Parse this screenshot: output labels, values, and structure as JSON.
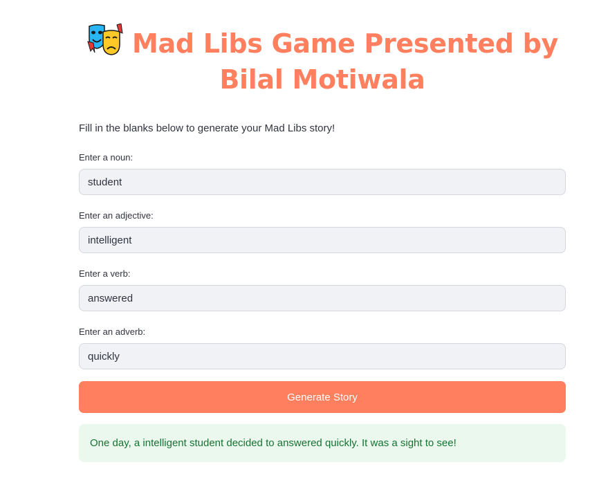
{
  "header": {
    "icon": "performing-arts-masks-icon",
    "title_line1": "Mad Libs Game Presented by",
    "title_line2": "Bilal Motiwala"
  },
  "intro_text": "Fill in the blanks below to generate your Mad Libs story!",
  "fields": [
    {
      "label": "Enter a noun:",
      "value": "student"
    },
    {
      "label": "Enter an adjective:",
      "value": "intelligent"
    },
    {
      "label": "Enter a verb:",
      "value": "answered"
    },
    {
      "label": "Enter an adverb:",
      "value": "quickly"
    }
  ],
  "button": {
    "label": "Generate Story"
  },
  "story": {
    "text": "One day, a intelligent student decided to answered quickly. It was a sight to see!"
  },
  "colors": {
    "accent": "#ff7f5e",
    "input_bg": "#f0f2f6",
    "success_bg": "#ebf8ee",
    "success_text": "#177233",
    "text": "#31333f"
  }
}
